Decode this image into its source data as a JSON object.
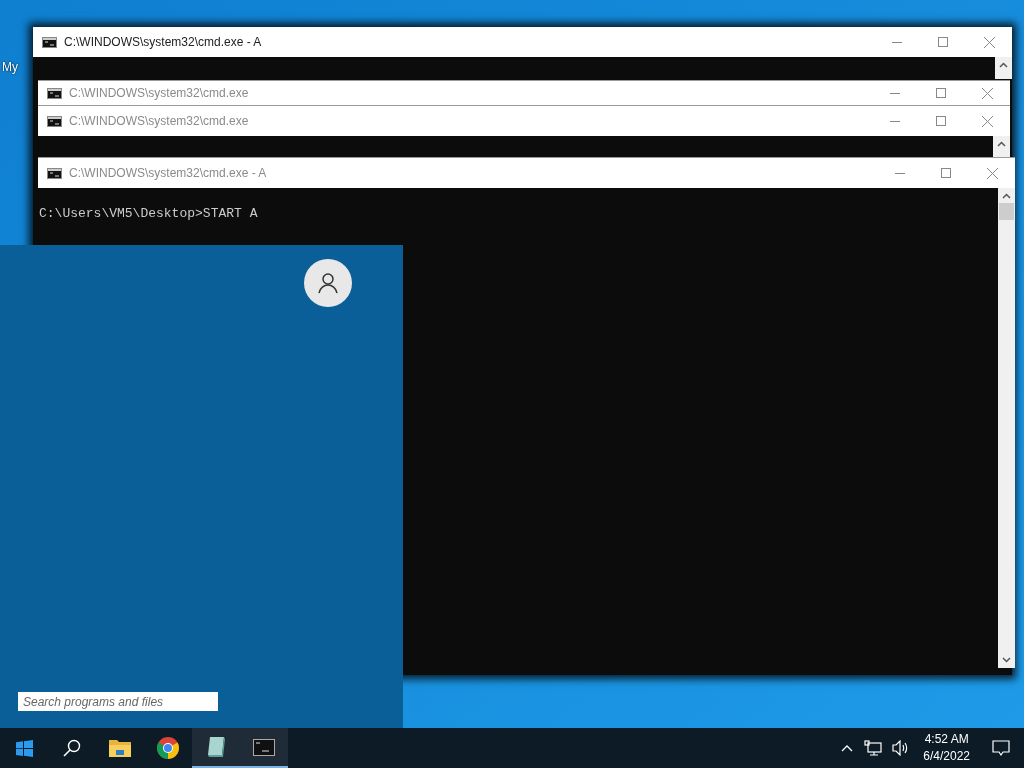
{
  "desktop": {
    "icons": [
      {
        "label": "My"
      }
    ]
  },
  "windows": [
    {
      "title": "C:\\WINDOWS\\system32\\cmd.exe - A",
      "active": true
    },
    {
      "title": "C:\\WINDOWS\\system32\\cmd.exe",
      "active": false
    },
    {
      "title": "C:\\WINDOWS\\system32\\cmd.exe",
      "active": false
    },
    {
      "title": "C:\\WINDOWS\\system32\\cmd.exe - A",
      "active": false,
      "lines": [
        "C:\\Users\\VM5\\Desktop>START A"
      ]
    }
  ],
  "start_menu": {
    "search": {
      "placeholder": "Search programs and files"
    }
  },
  "taskbar": {
    "apps": [
      {
        "kind": "start",
        "running": false
      },
      {
        "kind": "search",
        "running": false
      },
      {
        "kind": "folder",
        "running": false
      },
      {
        "kind": "chrome",
        "running": false
      },
      {
        "kind": "notepad",
        "running": true
      },
      {
        "kind": "cmd",
        "running": true
      }
    ],
    "time": "4:52 AM",
    "date": "6/4/2022"
  }
}
